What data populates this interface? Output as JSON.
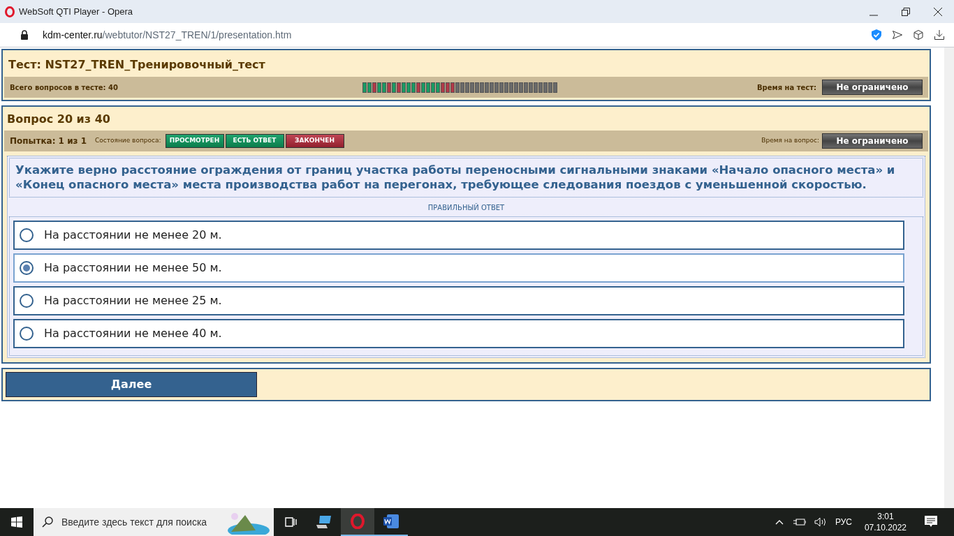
{
  "window": {
    "title": "WebSoft QTI Player - Opera"
  },
  "address_bar": {
    "host": "kdm-center.ru",
    "path": "/webtutor/NST27_TREN/1/presentation.htm"
  },
  "test": {
    "title": "Тест: NST27_TREN_Тренировочный_тест",
    "total_label": "Всего вопросов в тесте: 40",
    "time_label": "Время на тест:",
    "time_value": "Не ограничено",
    "progress": [
      {
        "color": "#1a9a63"
      },
      {
        "color": "#1a9a63"
      },
      {
        "color": "#b03a48"
      },
      {
        "color": "#1a9a63"
      },
      {
        "color": "#1a9a63"
      },
      {
        "color": "#b03a48"
      },
      {
        "color": "#1a9a63"
      },
      {
        "color": "#b03a48"
      },
      {
        "color": "#1a9a63"
      },
      {
        "color": "#1a9a63"
      },
      {
        "color": "#1a9a63"
      },
      {
        "color": "#b03a48"
      },
      {
        "color": "#1a9a63"
      },
      {
        "color": "#1a9a63"
      },
      {
        "color": "#1a9a63"
      },
      {
        "color": "#1a9a63"
      },
      {
        "color": "#b03a48"
      },
      {
        "color": "#b03a48"
      },
      {
        "color": "#b03a48"
      },
      {
        "color": "#6a6a6a"
      },
      {
        "color": "#6a6a6a"
      },
      {
        "color": "#6a6a6a"
      },
      {
        "color": "#6a6a6a"
      },
      {
        "color": "#6a6a6a"
      },
      {
        "color": "#6a6a6a"
      },
      {
        "color": "#6a6a6a"
      },
      {
        "color": "#6a6a6a"
      },
      {
        "color": "#6a6a6a"
      },
      {
        "color": "#6a6a6a"
      },
      {
        "color": "#6a6a6a"
      },
      {
        "color": "#6a6a6a"
      },
      {
        "color": "#6a6a6a"
      },
      {
        "color": "#6a6a6a"
      },
      {
        "color": "#6a6a6a"
      },
      {
        "color": "#6a6a6a"
      },
      {
        "color": "#6a6a6a"
      },
      {
        "color": "#6a6a6a"
      },
      {
        "color": "#6a6a6a"
      },
      {
        "color": "#6a6a6a"
      },
      {
        "color": "#6a6a6a"
      }
    ]
  },
  "question": {
    "title": "Вопрос 20 из 40",
    "attempt": "Попытка: 1 из 1",
    "state_label": "Состояние вопроса:",
    "states": [
      {
        "label": "ПРОСМОТРЕН",
        "kind": "ok"
      },
      {
        "label": "ЕСТЬ ОТВЕТ",
        "kind": "ok"
      },
      {
        "label": "ЗАКОНЧЕН",
        "kind": "done"
      }
    ],
    "time_label": "Время на вопрос:",
    "time_value": "Не ограничено",
    "text": "Укажите верно расстояние ограждения от границ участка работы переносными сигнальными знаками «Начало опасного места» и «Конец опасного места» места производства работ на перегонах, требующее следования поездов с уменьшенной скоростью.",
    "hint": "ПРАВИЛЬНЫЙ ОТВЕТ",
    "options": [
      {
        "label": "На расстоянии не менее 20 м.",
        "selected": false
      },
      {
        "label": "На расстоянии не менее 50 м.",
        "selected": true
      },
      {
        "label": "На расстоянии не менее 25 м.",
        "selected": false
      },
      {
        "label": "На расстоянии не менее 40 м.",
        "selected": false
      }
    ]
  },
  "next_button": "Далее",
  "taskbar": {
    "search_placeholder": "Введите здесь текст для поиска",
    "language": "РУС",
    "time": "3:01",
    "date": "07.10.2022"
  }
}
